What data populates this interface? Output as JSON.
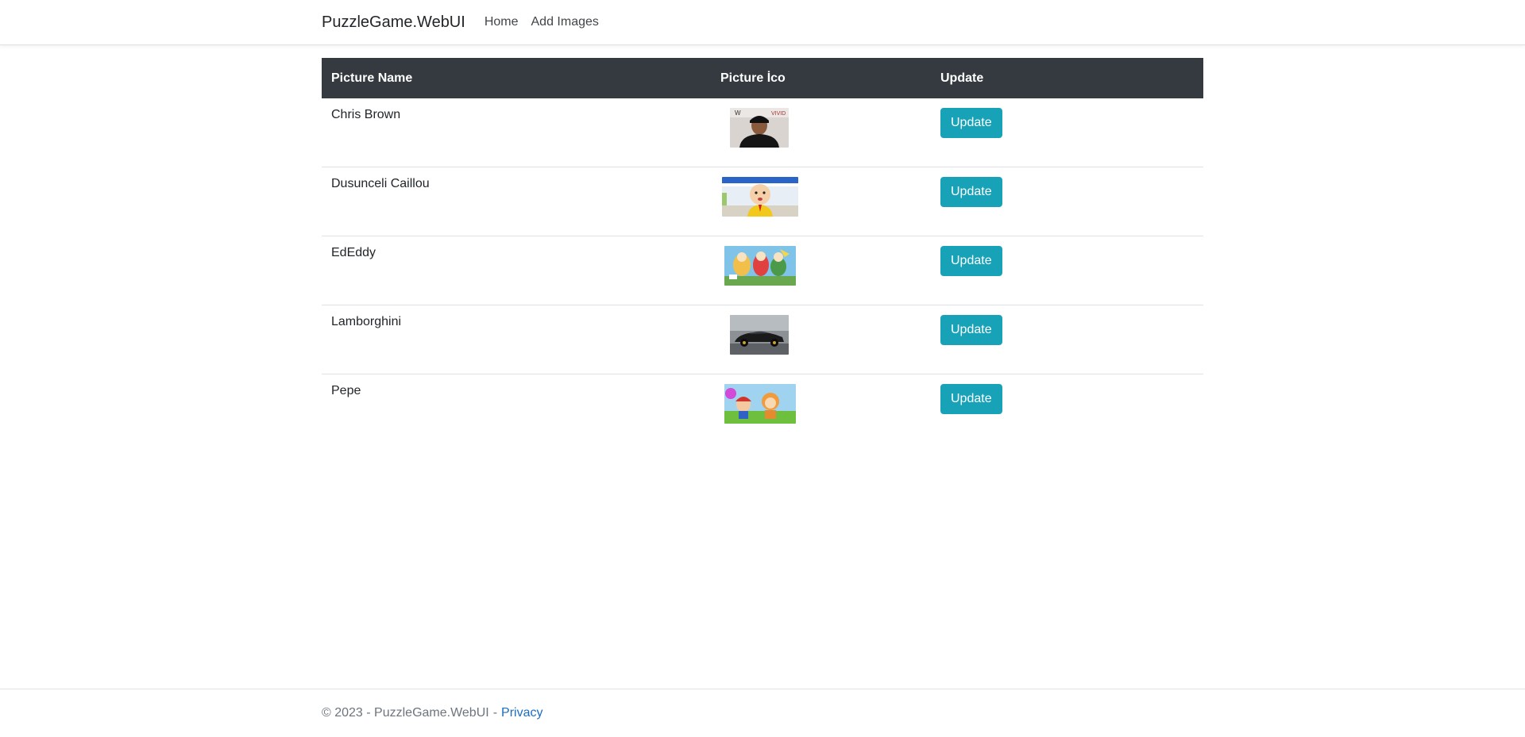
{
  "navbar": {
    "brand": "PuzzleGame.WebUI",
    "links": [
      "Home",
      "Add Images"
    ]
  },
  "table": {
    "headers": [
      "Picture Name",
      "Picture İco",
      "Update"
    ],
    "rows": [
      {
        "name": "Chris Brown",
        "icon": "portrait-photo",
        "button": "Update"
      },
      {
        "name": "Dusunceli Caillou",
        "icon": "cartoon-caillou",
        "button": "Update"
      },
      {
        "name": "EdEddy",
        "icon": "cartoon-ed-edd-eddy",
        "button": "Update"
      },
      {
        "name": "Lamborghini",
        "icon": "black-sports-car",
        "button": "Update"
      },
      {
        "name": "Pepe",
        "icon": "cartoon-pepe",
        "button": "Update"
      }
    ]
  },
  "footer": {
    "copyright": "© 2023 - PuzzleGame.WebUI",
    "separator": "-",
    "privacy_link": "Privacy"
  },
  "colors": {
    "header_bg": "#343a40",
    "button_bg": "#17a2b8",
    "link": "#1b6ec2"
  }
}
